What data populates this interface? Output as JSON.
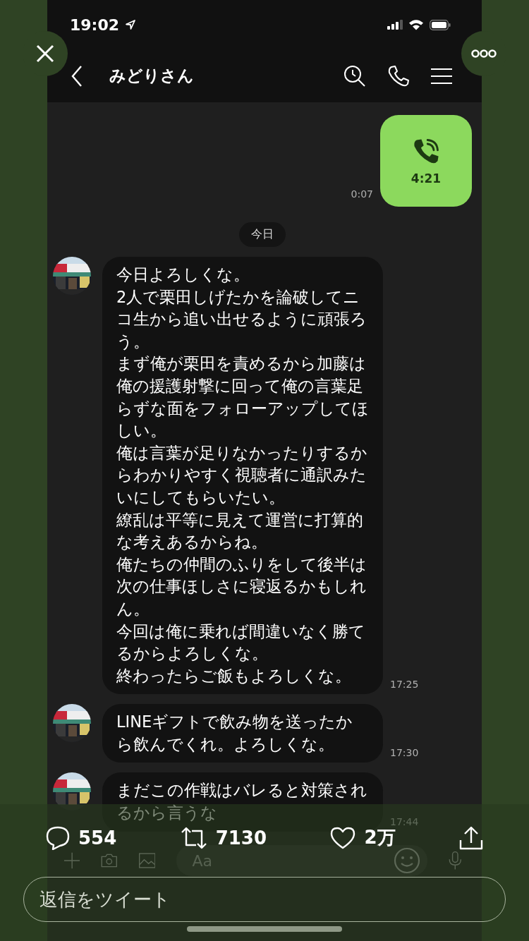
{
  "status_bar": {
    "time": "19:02"
  },
  "header": {
    "title": "みどりさん"
  },
  "messages": [
    {
      "kind": "call",
      "duration": "4:21",
      "time": "0:07"
    },
    {
      "kind": "date",
      "label": "今日"
    },
    {
      "kind": "text",
      "paragraphs": [
        "今日よろしくな。",
        "2人で栗田しげたかを論破してニコ生から追い出せるように頑張ろう。",
        "まず俺が栗田を責めるから加藤は俺の援護射撃に回って俺の言葉足らずな面をフォローアップしてほしい。",
        "俺は言葉が足りなかったりするからわかりやすく視聴者に通訳みたいにしてもらいたい。",
        "繚乱は平等に見えて運営に打算的な考えあるからね。",
        "俺たちの仲間のふりをして後半は次の仕事ほしさに寝返るかもしれん。",
        "今回は俺に乗れば間違いなく勝てるからよろしくな。",
        "終わったらご飯もよろしくな。"
      ],
      "time": "17:25"
    },
    {
      "kind": "text",
      "paragraphs": [
        "LINEギフトで飲み物を送ったから飲んでくれ。よろしくな。"
      ],
      "time": "17:30"
    },
    {
      "kind": "text",
      "paragraphs": [
        "まだこの作戦はバレると対策されるから言うな"
      ],
      "time": "17:44"
    }
  ],
  "input_bar": {
    "placeholder": "Aa"
  },
  "tweet_actions": {
    "replies": "554",
    "retweets": "7130",
    "likes": "2万"
  },
  "reply_field": {
    "placeholder": "返信をツイート"
  }
}
